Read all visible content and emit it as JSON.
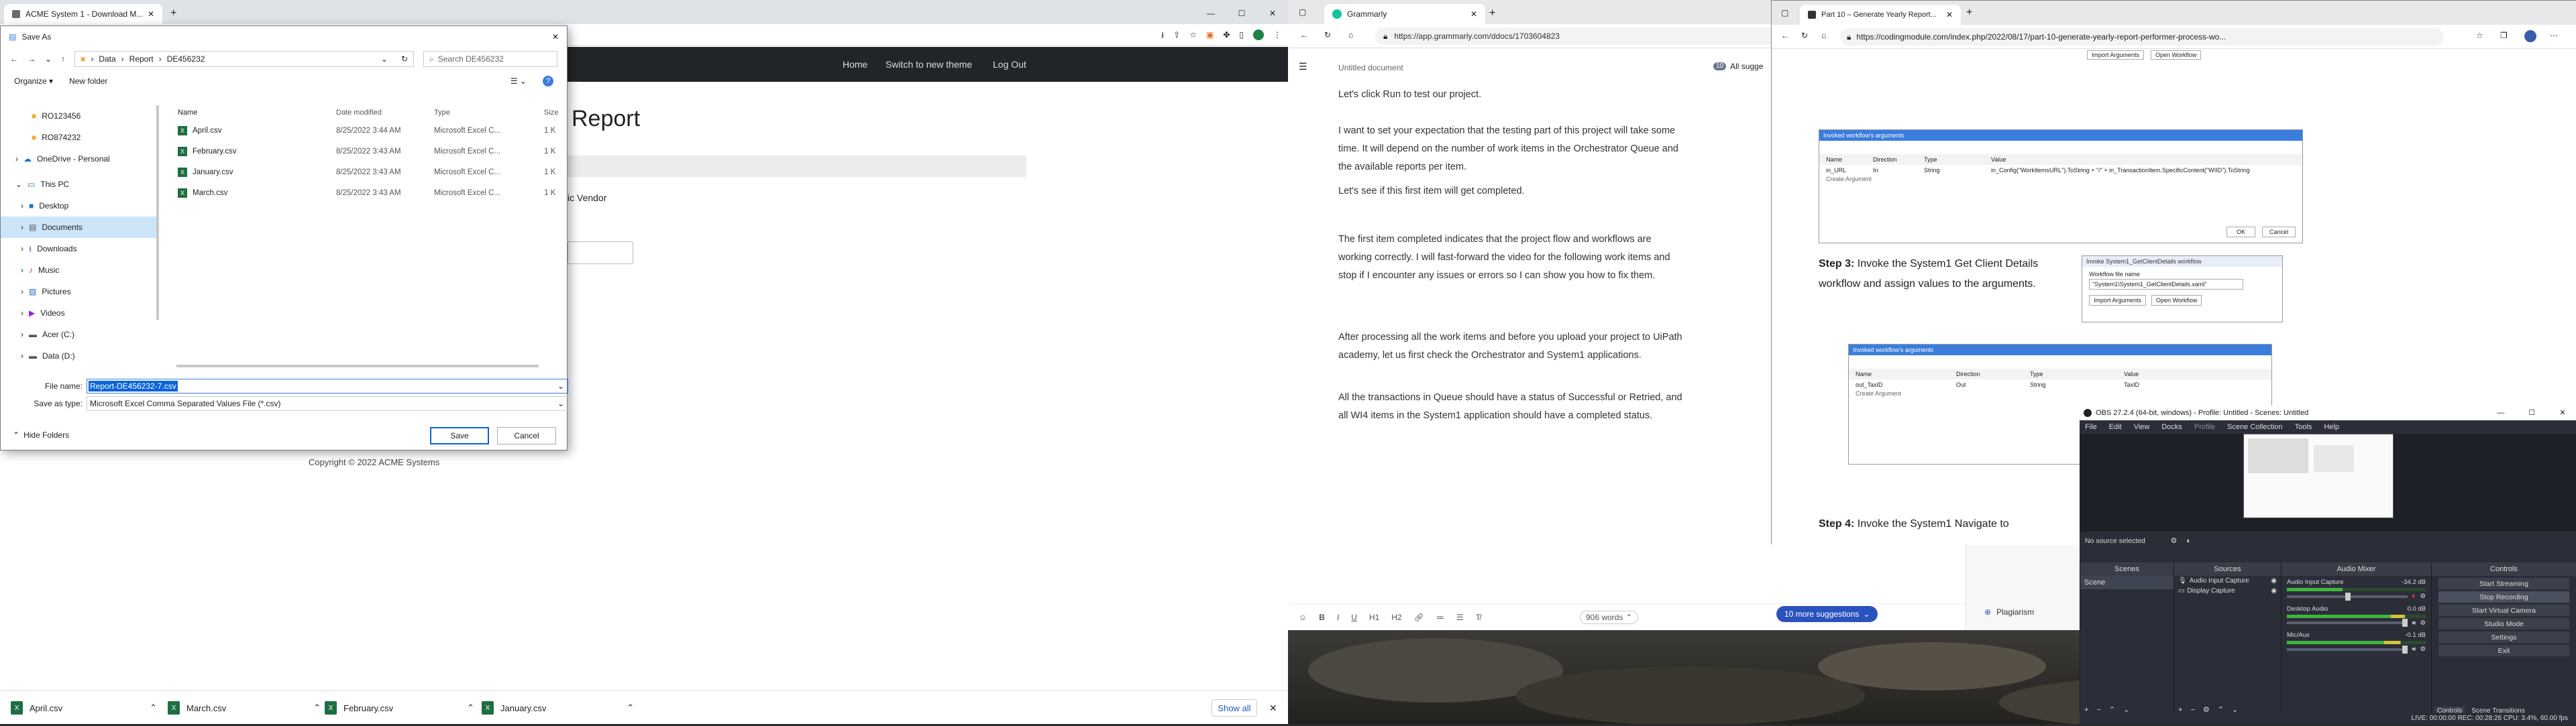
{
  "b1": {
    "tab_title": "ACME System 1 - Download M...",
    "nav": [
      "Home",
      "Switch to new theme",
      "Log Out"
    ],
    "heading_tail": "Report",
    "vendor_tail": "ic Vendor",
    "copyright": "Copyright © 2022 ACME Systems",
    "downloads": [
      {
        "name": "April.csv"
      },
      {
        "name": "March.csv"
      },
      {
        "name": "February.csv"
      },
      {
        "name": "January.csv"
      }
    ],
    "show_all": "Show all"
  },
  "dialog": {
    "title": "Save As",
    "path": [
      "Data",
      "Report",
      "DE456232"
    ],
    "search_placeholder": "Search DE456232",
    "organize": "Organize ▾",
    "new_folder": "New folder",
    "tree": [
      "RO123456",
      "RO874232",
      "OneDrive - Personal",
      "This PC",
      "Desktop",
      "Documents",
      "Downloads",
      "Music",
      "Pictures",
      "Videos",
      "Acer (C:)",
      "Data (D:)"
    ],
    "columns": [
      "Name",
      "Date modified",
      "Type",
      "Size"
    ],
    "files": [
      {
        "name": "April.csv",
        "date": "8/25/2022 3:44 AM",
        "type": "Microsoft Excel C...",
        "size": "1 K"
      },
      {
        "name": "February.csv",
        "date": "8/25/2022 3:43 AM",
        "type": "Microsoft Excel C...",
        "size": "1 K"
      },
      {
        "name": "January.csv",
        "date": "8/25/2022 3:43 AM",
        "type": "Microsoft Excel C...",
        "size": "1 K"
      },
      {
        "name": "March.csv",
        "date": "8/25/2022 3:43 AM",
        "type": "Microsoft Excel C...",
        "size": "1 K"
      }
    ],
    "file_name_label": "File name:",
    "file_name_value": "Report-DE456232-7.csv",
    "save_type_label": "Save as type:",
    "save_type_value": "Microsoft Excel Comma Separated Values File (*.csv)",
    "hide_folders": "Hide Folders",
    "save": "Save",
    "cancel": "Cancel"
  },
  "b2": {
    "tab_title": "Grammarly",
    "url": "https://app.grammarly.com/ddocs/1703604823",
    "doc_title": "Untitled document",
    "all_suggestions": "All sugge",
    "paragraphs": [
      "Let's click Run to test our project.",
      "I want to set your expectation that the testing part of this project will take some time. It will depend on the number of work items in the Orchestrator Queue and the available reports per item.",
      "Let's see if this first item will get completed.",
      "The first item completed indicates that the project flow and workflows are working correctly. I will fast-forward the video for the following work items and stop if I encounter any issues or errors so I can show you how to fix them.",
      "After processing all the work items and before you upload your project to UiPath academy, let us first check the Orchestrator and System1 applications.",
      "All the transactions in Queue should have a status of Successful or Retried, and all WI4 items in the System1 application should have a completed status."
    ],
    "suggestions": "10 more suggestions",
    "word_count": "906 words",
    "plagiarism": "Plagiarism",
    "badge": "10"
  },
  "b3": {
    "tab_title": "Part 10 – Generate Yearly Report...",
    "url": "https://codingmodule.com/index.php/2022/08/17/part-10-generate-yearly-report-performer-process-wo...",
    "step3_label": "Step 3:",
    "step3_text": "Invoke the System1 Get Client Details workflow and assign values to the arguments.",
    "step4_label": "Step 4:",
    "step4_text": "Invoke the System1 Navigate to",
    "dlg1_title": "Invoked workflow's arguments",
    "dlg1_row": [
      "in_URL",
      "In",
      "String",
      "in_Config(\"WorkItemsURL\").ToString + \"/\" + in_TransactionItem.SpecificContent(\"WIID\").ToString"
    ],
    "arg_cols": [
      "Name",
      "Direction",
      "Type",
      "Value"
    ],
    "create_arg": "Create Argument",
    "ok": "OK",
    "cancel": "Cancel",
    "invoke_title": "Invoke System1_GetClientDetails workflow",
    "wf_file_label": "Workflow file name",
    "wf_file_value": "\"System1\\System1_GetClientDetails.xaml\"",
    "import_args": "Import Arguments",
    "open_wf": "Open Workflow",
    "dlg2_row": [
      "out_TaxID",
      "Out",
      "String",
      "TaxID"
    ],
    "top_btns": [
      "Import Arguments",
      "Open Workflow"
    ]
  },
  "obs": {
    "title": "OBS 27.2.4 (64-bit, windows) - Profile: Untitled - Scenes: Untitled",
    "menu": [
      "File",
      "Edit",
      "View",
      "Docks",
      "Profile",
      "Scene Collection",
      "Tools",
      "Help"
    ],
    "no_source": "No source selected",
    "properties": "Properties",
    "filters": "Filters",
    "panels": [
      "Scenes",
      "Sources",
      "Audio Mixer",
      "Controls"
    ],
    "scene": "Scene",
    "sources": [
      "Audio Input Capture",
      "Display Capture"
    ],
    "mixer": [
      {
        "name": "Audio Input Capture",
        "db": "-34.2 dB"
      },
      {
        "name": "Desktop Audio",
        "db": "0.0 dB"
      },
      {
        "name": "Mic/Aux",
        "db": "-0.1 dB"
      }
    ],
    "controls": [
      "Start Streaming",
      "Stop Recording",
      "Start Virtual Camera",
      "Studio Mode",
      "Settings",
      "Exit"
    ],
    "status": "LIVE: 00:00:00   REC: 00:28:26   CPU: 3.4%, 60.00 fps",
    "tabs": [
      "Controls",
      "Scene Transitions"
    ]
  }
}
